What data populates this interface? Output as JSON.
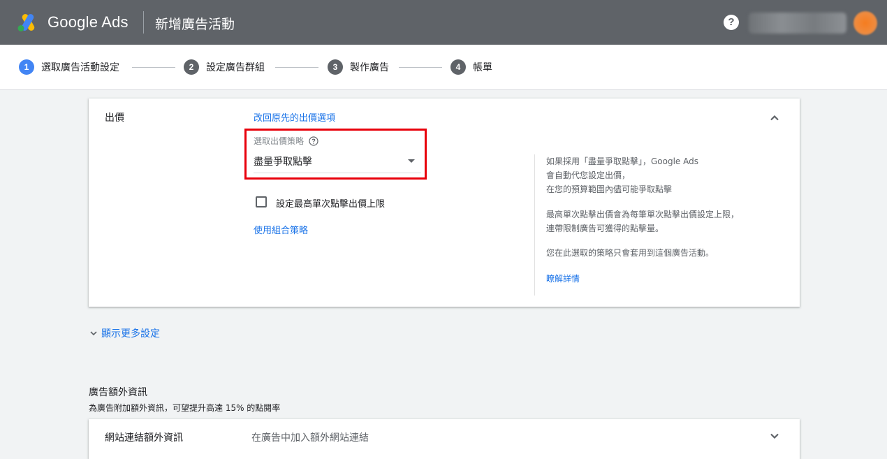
{
  "header": {
    "brand": "Google Ads",
    "page_title": "新增廣告活動",
    "help_glyph": "?"
  },
  "stepper": [
    {
      "num": "1",
      "label": "選取廣告活動設定",
      "active": true
    },
    {
      "num": "2",
      "label": "設定廣告群組",
      "active": false
    },
    {
      "num": "3",
      "label": "製作廣告",
      "active": false
    },
    {
      "num": "4",
      "label": "帳單",
      "active": false
    }
  ],
  "bidding": {
    "section_label": "出價",
    "restore_link": "改回原先的出價選項",
    "strategy_label": "選取出價策略",
    "strategy_value": "盡量爭取點擊",
    "max_cpc_checkbox_label": "設定最高單次點擊出價上限",
    "portfolio_link": "使用組合策略",
    "help_text_1a": "如果採用「盡量爭取點擊」，Google Ads",
    "help_text_1b": "會自動代您設定出價，",
    "help_text_1c": "在您的預算範圍內儘可能爭取點擊",
    "help_text_2a": "最高單次點擊出價會為每筆單次點擊出價設定上限，",
    "help_text_2b": "連帶限制廣告可獲得的點擊量。",
    "help_text_3": "您在此選取的策略只會套用到這個廣告活動。",
    "learn_more": "瞭解詳情"
  },
  "more_settings": "顯示更多設定",
  "extensions": {
    "title": "廣告額外資訊",
    "subtitle": "為廣告附加額外資訊，可望提升高達 15% 的點閱率",
    "sitelink_label": "網站連結額外資訊",
    "sitelink_hint": "在廣告中加入額外網站連結"
  },
  "colors": {
    "header_bg": "#5f6368",
    "accent": "#1a73e8",
    "active_step": "#4285f4",
    "highlight_box": "#e8000b"
  }
}
